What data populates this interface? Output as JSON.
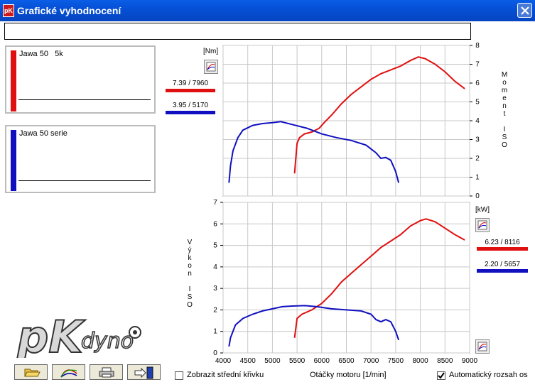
{
  "window": {
    "title": "Grafické vyhodnocení",
    "app_icon": "pk-app-icon",
    "close_icon": "close-icon"
  },
  "top_field": {
    "value": ""
  },
  "legend": [
    {
      "name": "Jawa 50   5k",
      "color": "#e01010"
    },
    {
      "name": "Jawa 50 serie",
      "color": "#1010c0"
    }
  ],
  "torque_panel": {
    "unit": "[Nm]",
    "title_vertical": "Moment ISO",
    "readouts": [
      {
        "text": "7.39 / 7960",
        "color": "#e01010"
      },
      {
        "text": "3.95 / 5170",
        "color": "#1010c0"
      }
    ]
  },
  "power_panel": {
    "unit": "[kW]",
    "title_vertical": "Výkon ISO",
    "readouts": [
      {
        "text": "6.23 / 8116",
        "color": "#e01010"
      },
      {
        "text": "2.20 / 5657",
        "color": "#1010c0"
      }
    ]
  },
  "x_axis_label": "Otáčky motoru [1/min]",
  "options": {
    "mean_curve": {
      "label": "Zobrazit střední křivku",
      "checked": false
    },
    "auto_range": {
      "label": "Automatický rozsah os",
      "checked": true
    }
  },
  "toolbar": {
    "buttons": [
      "open-folder-icon",
      "curve-icon",
      "print-icon",
      "exit-icon"
    ]
  },
  "logo_text": {
    "pk": "pK",
    "dyno": "dyno"
  },
  "chart_data": [
    {
      "type": "line",
      "title": "",
      "ylabel": "Moment ISO",
      "unit": "[Nm]",
      "xlim": [
        4000,
        9000
      ],
      "ylim": [
        0,
        8
      ],
      "x_ticks": [
        4000,
        4500,
        5000,
        5500,
        6000,
        6500,
        7000,
        7500,
        8000,
        8500,
        9000
      ],
      "y_ticks": [
        0,
        1,
        2,
        3,
        4,
        5,
        6,
        7,
        8
      ],
      "y_axis_side": "right",
      "grid": true,
      "series": [
        {
          "name": "Jawa 50   5k",
          "color": "#e01010",
          "x": [
            5450,
            5500,
            5550,
            5650,
            5800,
            5950,
            6050,
            6200,
            6400,
            6600,
            6800,
            7000,
            7200,
            7400,
            7600,
            7800,
            7960,
            8100,
            8300,
            8500,
            8700,
            8900
          ],
          "y": [
            1.2,
            2.8,
            3.1,
            3.3,
            3.4,
            3.6,
            3.9,
            4.3,
            4.9,
            5.4,
            5.8,
            6.2,
            6.5,
            6.7,
            6.9,
            7.2,
            7.39,
            7.3,
            7.0,
            6.6,
            6.1,
            5.7
          ]
        },
        {
          "name": "Jawa 50 serie",
          "color": "#1010c0",
          "x": [
            4120,
            4150,
            4200,
            4300,
            4400,
            4600,
            4800,
            5000,
            5170,
            5400,
            5700,
            6000,
            6300,
            6600,
            6900,
            7100,
            7200,
            7300,
            7400,
            7500,
            7560
          ],
          "y": [
            0.7,
            1.6,
            2.4,
            3.1,
            3.5,
            3.75,
            3.85,
            3.9,
            3.95,
            3.8,
            3.6,
            3.3,
            3.1,
            2.95,
            2.7,
            2.3,
            2.0,
            2.05,
            1.9,
            1.3,
            0.7
          ]
        }
      ]
    },
    {
      "type": "line",
      "title": "",
      "ylabel": "Výkon ISO",
      "unit": "[kW]",
      "xlabel": "Otáčky motoru [1/min]",
      "xlim": [
        4000,
        9000
      ],
      "ylim": [
        0,
        7
      ],
      "x_ticks": [
        4000,
        4500,
        5000,
        5500,
        6000,
        6500,
        7000,
        7500,
        8000,
        8500,
        9000
      ],
      "y_ticks": [
        0,
        1,
        2,
        3,
        4,
        5,
        6,
        7
      ],
      "y_axis_side": "left",
      "grid": true,
      "series": [
        {
          "name": "Jawa 50   5k",
          "color": "#e01010",
          "x": [
            5450,
            5500,
            5600,
            5800,
            6000,
            6200,
            6400,
            6600,
            6800,
            7000,
            7200,
            7400,
            7600,
            7800,
            8000,
            8116,
            8300,
            8500,
            8700,
            8900
          ],
          "y": [
            0.7,
            1.6,
            1.8,
            2.0,
            2.3,
            2.75,
            3.3,
            3.7,
            4.1,
            4.5,
            4.9,
            5.2,
            5.5,
            5.9,
            6.15,
            6.23,
            6.1,
            5.8,
            5.5,
            5.25
          ]
        },
        {
          "name": "Jawa 50 serie",
          "color": "#1010c0",
          "x": [
            4120,
            4150,
            4250,
            4400,
            4600,
            4800,
            5000,
            5200,
            5400,
            5657,
            5900,
            6200,
            6500,
            6800,
            7000,
            7100,
            7200,
            7300,
            7400,
            7500,
            7560
          ],
          "y": [
            0.3,
            0.7,
            1.3,
            1.6,
            1.8,
            1.95,
            2.05,
            2.15,
            2.18,
            2.2,
            2.15,
            2.05,
            2.0,
            1.95,
            1.8,
            1.55,
            1.45,
            1.55,
            1.45,
            1.0,
            0.6
          ]
        }
      ]
    }
  ]
}
